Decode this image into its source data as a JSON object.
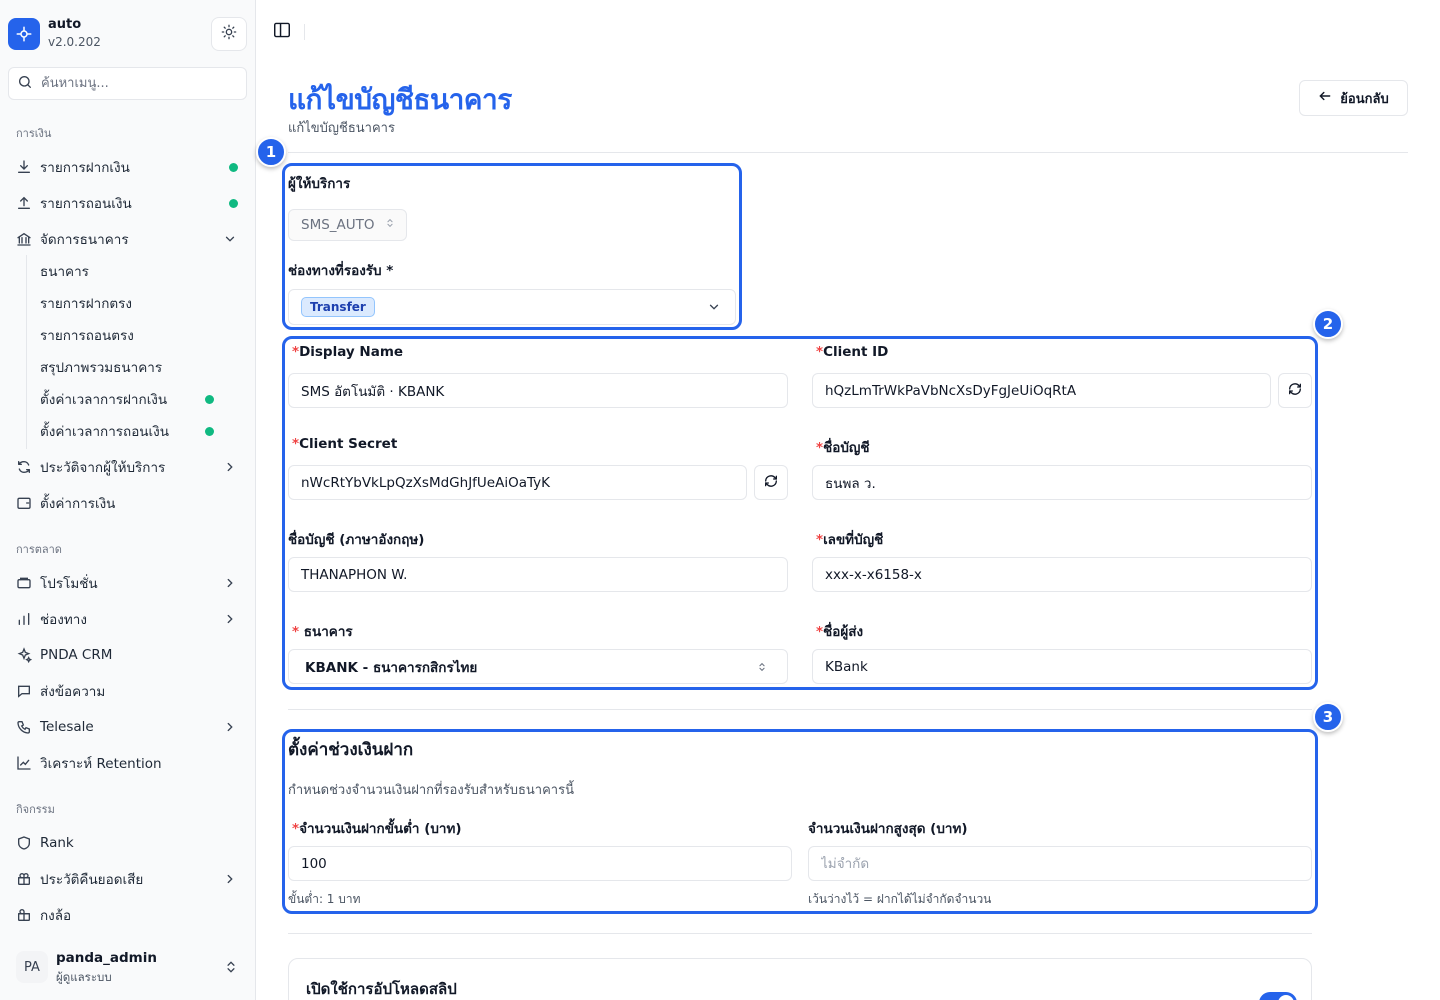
{
  "app": {
    "name": "auto",
    "version": "v2.0.202"
  },
  "search": {
    "placeholder": "ค้นหาเมนู..."
  },
  "sidebar": {
    "sections": {
      "finance": "การเงิน",
      "marketing": "การตลาด",
      "activities": "กิจกรรม"
    },
    "items": {
      "deposits": "รายการฝากเงิน",
      "withdrawals": "รายการถอนเงิน",
      "bank_manage": "จัดการธนาคาร",
      "provider_history": "ประวัติจากผู้ให้บริการ",
      "finance_settings": "ตั้งค่าการเงิน",
      "promotions": "โปรโมชั่น",
      "channels": "ช่องทาง",
      "crm": "PNDA CRM",
      "messages": "ส่งข้อความ",
      "telesale": "Telesale",
      "retention": "วิเคราะห์ Retention",
      "rank": "Rank",
      "loss_refund": "ประวัติคืนยอดเสีย",
      "gacha": "กงล้อ"
    },
    "bank_sub": {
      "banks": "ธนาคาร",
      "direct_deposits": "รายการฝากตรง",
      "direct_withdrawals": "รายการถอนตรง",
      "bank_summary": "สรุปภาพรวมธนาคาร",
      "deposit_time": "ตั้งค่าเวลาการฝากเงิน",
      "withdraw_time": "ตั้งค่าเวลาการถอนเงิน"
    },
    "status_color": "#10b981"
  },
  "user": {
    "initials": "PA",
    "name": "panda_admin",
    "role": "ผู้ดูแลระบบ"
  },
  "page": {
    "title": "แก้ไขบัญชีธนาคาร",
    "subtitle": "แก้ไขบัญชีธนาคาร",
    "back_label": "ย้อนกลับ",
    "accent": "#2563eb"
  },
  "step_badges": [
    "1",
    "2",
    "3"
  ],
  "form": {
    "provider": {
      "label": "ผู้ให้บริการ",
      "value": "SMS_AUTO"
    },
    "channels": {
      "label": "ช่องทางที่รองรับ *",
      "tag": "Transfer"
    },
    "display_name": {
      "label": "Display Name",
      "value": "SMS อัตโนมัติ · KBANK"
    },
    "client_id": {
      "label": "Client ID",
      "value": "hQzLmTrWkPaVbNcXsDyFgJeUiOqRtA"
    },
    "client_secret": {
      "label": "Client Secret",
      "value": "nWcRtYbVkLpQzXsMdGhJfUeAiOaTyK"
    },
    "account_name": {
      "label": "ชื่อบัญชี",
      "value": "ธนพล ว."
    },
    "account_name_en": {
      "label": "ชื่อบัญชี (ภาษาอังกฤษ)",
      "value": "THANAPHON W."
    },
    "account_number": {
      "label": "เลขที่บัญชี",
      "value": "xxx-x-x6158-x"
    },
    "bank": {
      "label": " ธนาคาร",
      "value": "KBANK - ธนาคารกสิกรไทย"
    },
    "sender_name": {
      "label": "ชื่อผู้ส่ง",
      "value": "KBank"
    },
    "required_mark": "*"
  },
  "deposit_range": {
    "title": "ตั้งค่าช่วงเงินฝาก",
    "description": "กำหนดช่วงจำนวนเงินฝากที่รองรับสำหรับธนาคารนี้",
    "min_label": "จำนวนเงินฝากขั้นต่ำ (บาท)",
    "min_value": "100",
    "min_hint": "ขั้นต่ำ: 1 บาท",
    "max_label": "จำนวนเงินฝากสูงสุด (บาท)",
    "max_placeholder": "ไม่จำกัด",
    "max_hint": "เว้นว่างไว้ = ฝากได้ไม่จำกัดจำนวน"
  },
  "slip": {
    "title": "เปิดใช้การอัปโหลดสลิป",
    "enabled": true
  }
}
